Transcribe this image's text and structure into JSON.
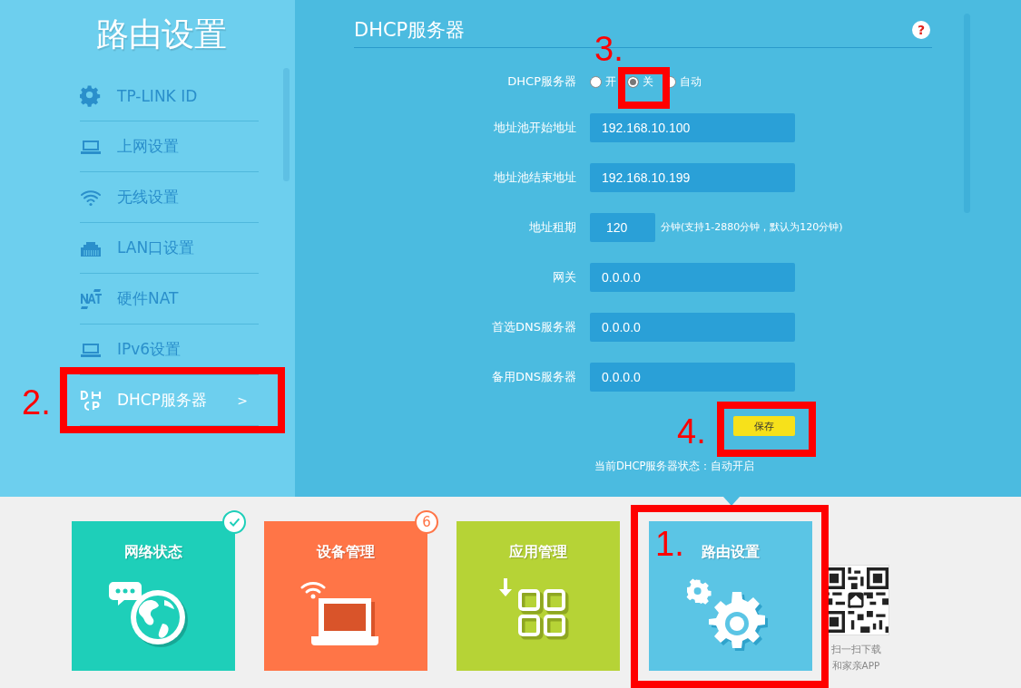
{
  "sidebar": {
    "title": "路由设置",
    "items": [
      {
        "kind": "gear",
        "label": "TP-LINK ID",
        "selected": false
      },
      {
        "kind": "laptop",
        "label": "上网设置",
        "selected": false
      },
      {
        "kind": "wifi",
        "label": "无线设置",
        "selected": false
      },
      {
        "kind": "lan",
        "label": "LAN口设置",
        "selected": false
      },
      {
        "kind": "nat",
        "label": "硬件NAT",
        "selected": false
      },
      {
        "kind": "laptop",
        "label": "IPv6设置",
        "selected": false
      },
      {
        "kind": "dhcp",
        "label": "DHCP服务器",
        "selected": true,
        "arrow": ">"
      }
    ]
  },
  "panel": {
    "title": "DHCP服务器",
    "help": "?",
    "server": {
      "label": "DHCP服务器",
      "options": [
        {
          "label": "开",
          "selected": false
        },
        {
          "label": "关",
          "selected": true
        },
        {
          "label": "自动",
          "selected": false
        }
      ]
    },
    "fields": [
      {
        "label": "地址池开始地址",
        "value": "192.168.10.100"
      },
      {
        "label": "地址池结束地址",
        "value": "192.168.10.199"
      },
      {
        "label": "地址租期",
        "value": "120",
        "hint": "分钟(支持1-2880分钟，默认为120分钟)"
      },
      {
        "label": "网关",
        "value": "0.0.0.0"
      },
      {
        "label": "首选DNS服务器",
        "value": "0.0.0.0"
      },
      {
        "label": "备用DNS服务器",
        "value": "0.0.0.0"
      }
    ],
    "save": "保存",
    "status": "当前DHCP服务器状态：自动开启"
  },
  "tiles": [
    {
      "kind": "network",
      "label": "网络状态",
      "color": "#1ecfb9",
      "checked": true
    },
    {
      "kind": "devices",
      "label": "设备管理",
      "color": "#ff7547",
      "checked": false,
      "badge": "6"
    },
    {
      "kind": "apps",
      "label": "应用管理",
      "color": "#b6d336",
      "checked": false
    },
    {
      "kind": "router",
      "label": "路由设置",
      "color": "#5bc5e5",
      "checked": false
    }
  ],
  "qr": {
    "caption": [
      "扫一扫下载",
      "和家亲APP"
    ]
  },
  "annotations": [
    {
      "kind": "tile",
      "number": "1."
    },
    {
      "kind": "menu",
      "number": "2."
    },
    {
      "kind": "radio",
      "number": "3."
    },
    {
      "kind": "save",
      "number": "4."
    }
  ]
}
